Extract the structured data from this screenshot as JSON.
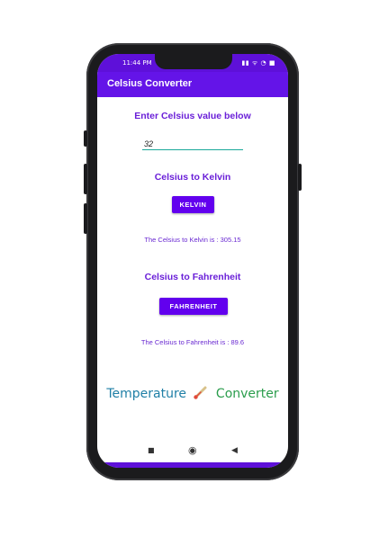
{
  "status": {
    "time": "11:44 PM",
    "icons": "▮▮ ᯤ ◔ ■"
  },
  "appbar": {
    "title": "Celsius Converter"
  },
  "form": {
    "prompt": "Enter Celsius value below",
    "input_value": "32",
    "kelvin_heading": "Celsius to Kelvin",
    "kelvin_button": "KELVIN",
    "kelvin_result": "The Celsius to Kelvin is : 305.15",
    "fahrenheit_heading": "Celsius to Fahrenheit",
    "fahrenheit_button": "FAHRENHEIT",
    "fahrenheit_result": "The Celsius to Fahrenheit is : 89.6"
  },
  "logo": {
    "word1": "Temperature",
    "word2": "Converter",
    "icon": "thermometer-icon"
  },
  "navbar": {
    "recents": "■",
    "home": "◉",
    "back": "◀"
  },
  "colors": {
    "primary": "#6200ee",
    "appbar": "#6414e8",
    "accent": "#1aa89a",
    "text": "#6a1fd8"
  }
}
